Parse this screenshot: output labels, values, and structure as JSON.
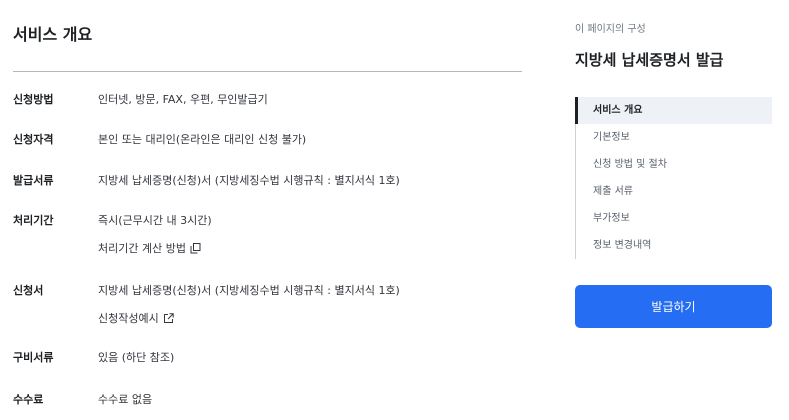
{
  "main": {
    "section_title": "서비스 개요",
    "rows": [
      {
        "label": "신청방법",
        "value": "인터넷, 방문, FAX, 우편, 무인발급기"
      },
      {
        "label": "신청자격",
        "value": "본인 또는 대리인(온라인은 대리인 신청 불가)"
      },
      {
        "label": "발급서류",
        "value": "지방세 납세증명(신청)서 (지방세징수법 시행규칙 : 별지서식 1호)"
      },
      {
        "label": "처리기간",
        "value": "즉시(근무시간 내 3시간)",
        "sub_link": "처리기간 계산 방법",
        "sub_icon": "copy-icon"
      },
      {
        "label": "신청서",
        "value": "지방세 납세증명(신청)서 (지방세징수법 시행규칙 : 별지서식 1호)",
        "sub_link": "신청작성예시",
        "sub_icon": "external-link-icon"
      },
      {
        "label": "구비서류",
        "value": "있음 (하단 참조)"
      },
      {
        "label": "수수료",
        "value": "수수료 없음"
      }
    ]
  },
  "aside": {
    "caption": "이 페이지의 구성",
    "title": "지방세 납세증명서 발급",
    "toc": [
      {
        "label": "서비스 개요",
        "active": true
      },
      {
        "label": "기본정보",
        "active": false
      },
      {
        "label": "신청 방법 및 절차",
        "active": false
      },
      {
        "label": "제출 서류",
        "active": false
      },
      {
        "label": "부가정보",
        "active": false
      },
      {
        "label": "정보 변경내역",
        "active": false
      }
    ],
    "issue_button": "발급하기"
  },
  "colors": {
    "primary": "#256ef4",
    "text": "#1e2124",
    "muted": "#6d7882",
    "active_bg": "#eef2f7"
  }
}
